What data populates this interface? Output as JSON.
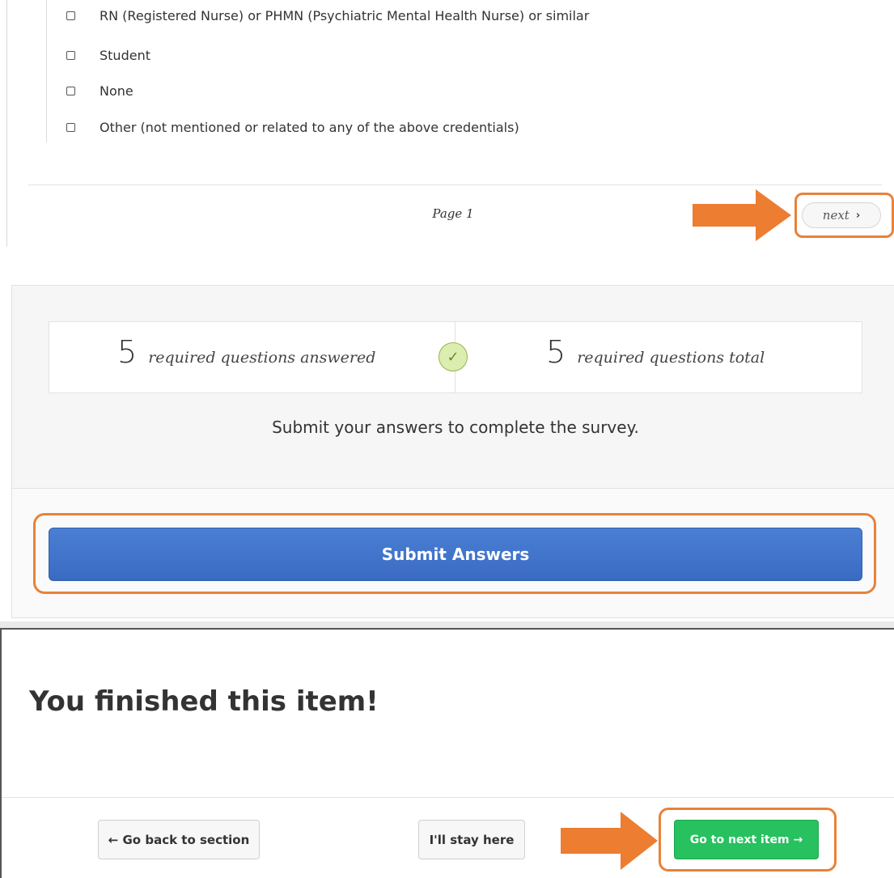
{
  "checklist": {
    "options": [
      {
        "label": "RN (Registered Nurse) or PHMN (Psychiatric Mental Health Nurse) or similar",
        "checked": false
      },
      {
        "label": "Student",
        "checked": false
      },
      {
        "label": "None",
        "checked": false
      },
      {
        "label": "Other (not mentioned or related to any of the above credentials)",
        "checked": false
      }
    ]
  },
  "pager": {
    "page_label": "Page 1",
    "next_label": "next",
    "next_icon": "chevron-right-icon"
  },
  "summary": {
    "answered_count": "5",
    "answered_text": "required questions answered",
    "check_icon": "check-circle-icon",
    "total_count": "5",
    "total_text": "required questions total",
    "message": "Submit your answers to complete the survey.",
    "submit_label": "Submit Answers"
  },
  "finished": {
    "title": "You finished this item!",
    "back_label": "← Go back to section",
    "stay_label": "I'll stay here",
    "next_label": "Go to next item →"
  },
  "colors": {
    "highlight": "#e8823a",
    "arrow": "#ec7d31",
    "submit": "#3f72c8",
    "next_item": "#27c15f"
  }
}
